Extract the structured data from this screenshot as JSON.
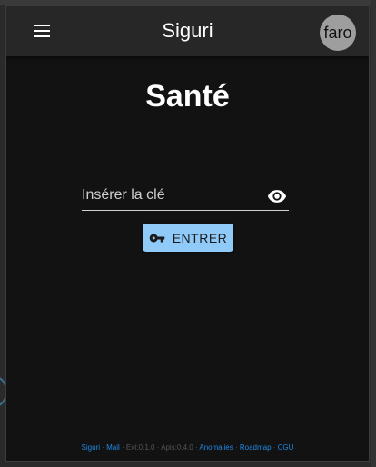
{
  "appbar": {
    "title": "Siguri",
    "avatar_text": "faro"
  },
  "page": {
    "heading": "Santé"
  },
  "key_input": {
    "placeholder": "Insérer la clé",
    "value": ""
  },
  "enter_button": {
    "label": "ENTRER"
  },
  "footer": {
    "siguri": "Siguri",
    "mail": "Mail",
    "ext_version": "Ext:0.1.0",
    "apis_version": "Apis:0.4.0",
    "anomalies": "Anomalies",
    "roadmap": "Roadmap",
    "cgu": "CGU",
    "separator": " · "
  },
  "colors": {
    "accent": "#90caf9",
    "link": "#1e88e5",
    "background": "#121212",
    "appbar": "#272727"
  }
}
